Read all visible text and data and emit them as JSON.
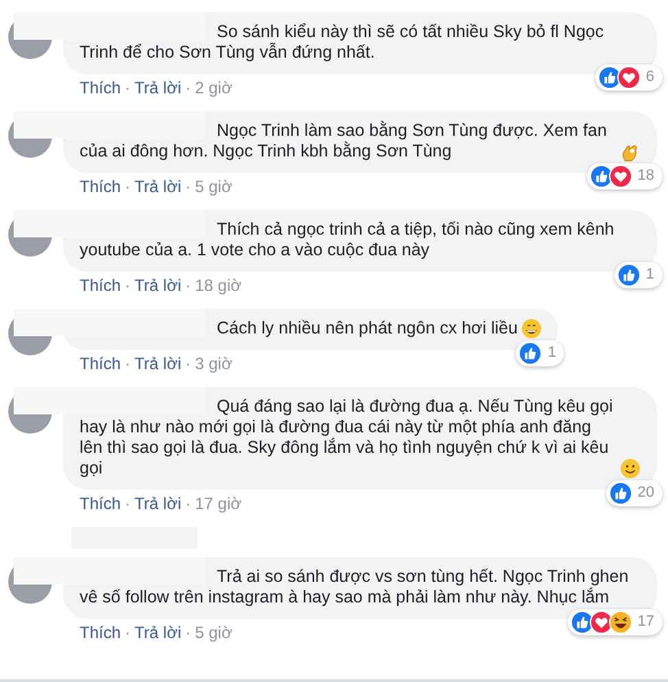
{
  "comments": [
    {
      "kind": "comment",
      "text": "So sánh kiểu này thì sẽ có tất nhiều Sky bỏ fl Ngọc Trinh để cho Sơn Tùng vẫn đứng nhất.",
      "reactions": [
        {
          "kind": "like"
        },
        {
          "kind": "love"
        }
      ],
      "count": "6",
      "actions": [
        {
          "kind": "link",
          "text": "Thích"
        },
        {
          "kind": "sep",
          "text": "·"
        },
        {
          "kind": "link",
          "text": "Trả lời"
        },
        {
          "kind": "sep",
          "text": "·"
        },
        {
          "kind": "time",
          "text": "2 giờ"
        }
      ]
    },
    {
      "kind": "comment",
      "text": "Ngọc Trinh làm sao bằng Sơn Tùng được. Xem fan của ai đông hơn. Ngọc Trinh kbh bằng Sơn Tùng",
      "emoji": {
        "kind": "ok"
      },
      "reactions": [
        {
          "kind": "like"
        },
        {
          "kind": "love"
        }
      ],
      "count": "18",
      "actions": [
        {
          "kind": "link",
          "text": "Thích"
        },
        {
          "kind": "sep",
          "text": "·"
        },
        {
          "kind": "link",
          "text": "Trả lời"
        },
        {
          "kind": "sep",
          "text": "·"
        },
        {
          "kind": "time",
          "text": "5 giờ"
        }
      ]
    },
    {
      "kind": "comment",
      "text": "Thích cả ngọc trinh cả a tiệp, tối nào cũng xem kênh youtube của a. 1 vote cho a vào cuộc đua này",
      "reactions": [
        {
          "kind": "like"
        }
      ],
      "count": "1",
      "actions": [
        {
          "kind": "link",
          "text": "Thích"
        },
        {
          "kind": "sep",
          "text": "·"
        },
        {
          "kind": "link",
          "text": "Trả lời"
        },
        {
          "kind": "sep",
          "text": "·"
        },
        {
          "kind": "time",
          "text": "18 giờ"
        }
      ]
    },
    {
      "kind": "comment",
      "text": "Cách ly nhiều nên phát ngôn cx hơi liều",
      "emoji": {
        "kind": "grin"
      },
      "reactions": [
        {
          "kind": "like"
        }
      ],
      "count": "1",
      "actions": [
        {
          "kind": "link",
          "text": "Thích"
        },
        {
          "kind": "sep",
          "text": "·"
        },
        {
          "kind": "link",
          "text": "Trả lời"
        },
        {
          "kind": "sep",
          "text": "·"
        },
        {
          "kind": "time",
          "text": "3 giờ"
        }
      ]
    },
    {
      "kind": "comment",
      "text": "Quá đáng sao lại là đường đua ạ. Nếu Tùng kêu gọi hay là như nào mới gọi là đường đua cái này từ một phía anh đăng lên thì sao gọi là đua. Sky đông lắm và họ tình nguyện chứ k vì ai kêu gọi",
      "emoji": {
        "kind": "smile"
      },
      "reactions": [
        {
          "kind": "like"
        }
      ],
      "count": "20",
      "actions": [
        {
          "kind": "link",
          "text": "Thích"
        },
        {
          "kind": "sep",
          "text": "·"
        },
        {
          "kind": "link",
          "text": "Trả lời"
        },
        {
          "kind": "sep",
          "text": "·"
        },
        {
          "kind": "time",
          "text": "17 giờ"
        }
      ]
    },
    {
      "kind": "redacted"
    },
    {
      "kind": "comment",
      "text": "Trả ai so sánh được vs sơn tùng hết. Ngọc Trinh ghen vê số follow trên instagram à hay sao mà phải làm như này. Nhục lắm",
      "reactions": [
        {
          "kind": "like"
        },
        {
          "kind": "love"
        },
        {
          "kind": "haha"
        }
      ],
      "count": "17",
      "actions": [
        {
          "kind": "link",
          "text": "Thích"
        },
        {
          "kind": "sep",
          "text": "·"
        },
        {
          "kind": "link",
          "text": "Trả lời"
        },
        {
          "kind": "sep",
          "text": "·"
        },
        {
          "kind": "time",
          "text": "5 giờ"
        }
      ]
    }
  ]
}
